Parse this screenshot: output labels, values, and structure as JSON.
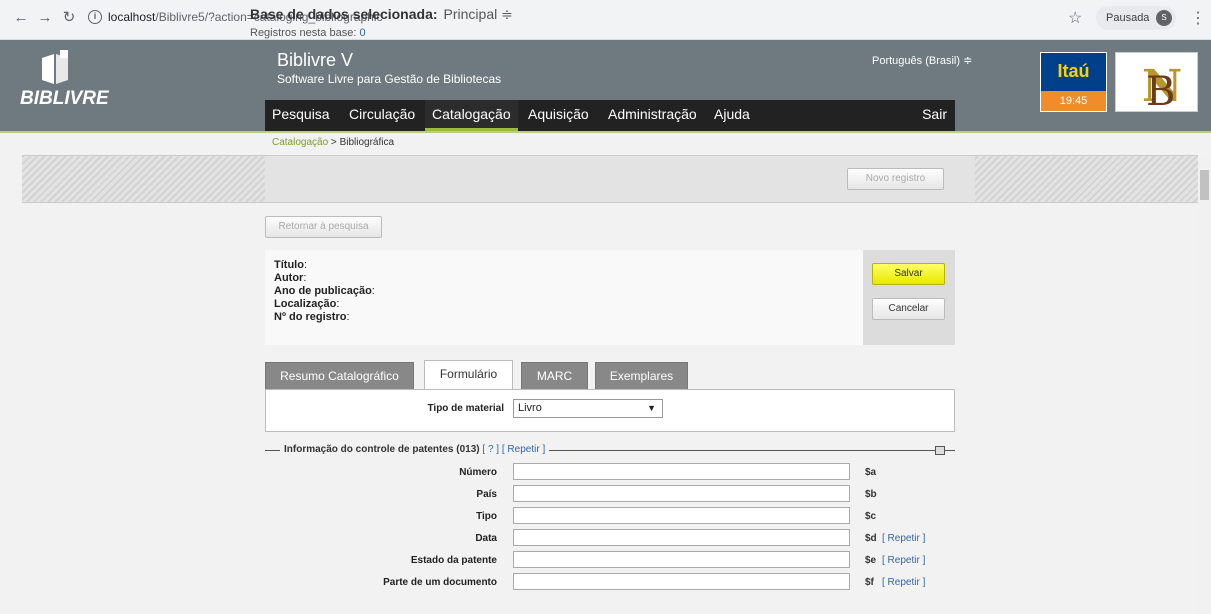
{
  "browser": {
    "url_host": "localhost",
    "url_path": "/Biblivre5/?action=cataloging_bibliographic",
    "profile_label": "Pausada",
    "profile_initial": "S"
  },
  "header": {
    "logo_text": "BIBLIVRE",
    "title": "Biblivre V",
    "subtitle": "Software Livre para Gestão de Bibliotecas",
    "language": "Português (Brasil) ≑",
    "sponsor": "Itaú",
    "clock": "19:45"
  },
  "menu": {
    "items": [
      "Pesquisa",
      "Circulação",
      "Catalogação",
      "Aquisição",
      "Administração",
      "Ajuda"
    ],
    "logout": "Sair"
  },
  "breadcrumb": {
    "parent": "Catalogação",
    "sep": " > ",
    "current": "Bibliográfica"
  },
  "database": {
    "label": "Base de dados selecionada:",
    "selected": "Principal ≑",
    "count_label": "Registros nesta base:",
    "count": "0",
    "new_record": "Novo registro"
  },
  "back_button": "Retornar à pesquisa",
  "record": {
    "labels": [
      "Título",
      "Autor",
      "Ano de publicação",
      "Localização",
      "Nº do registro"
    ],
    "save": "Salvar",
    "cancel": "Cancelar"
  },
  "tabs": [
    "Resumo Catalográfico",
    "Formulário",
    "MARC",
    "Exemplares"
  ],
  "material": {
    "label": "Tipo de material",
    "value": "Livro"
  },
  "fieldset": {
    "title": "Informação do controle de patentes",
    "tag": "(013)",
    "help": "[ ? ]",
    "repeat": "[ Repetir ]",
    "fields": [
      {
        "label": "Número",
        "sub": "$a",
        "repeat": ""
      },
      {
        "label": "País",
        "sub": "$b",
        "repeat": ""
      },
      {
        "label": "Tipo",
        "sub": "$c",
        "repeat": ""
      },
      {
        "label": "Data",
        "sub": "$d",
        "repeat": "[ Repetir ]"
      },
      {
        "label": "Estado da patente",
        "sub": "$e",
        "repeat": "[ Repetir ]"
      },
      {
        "label": "Parte de um documento",
        "sub": "$f",
        "repeat": "[ Repetir ]"
      }
    ]
  }
}
